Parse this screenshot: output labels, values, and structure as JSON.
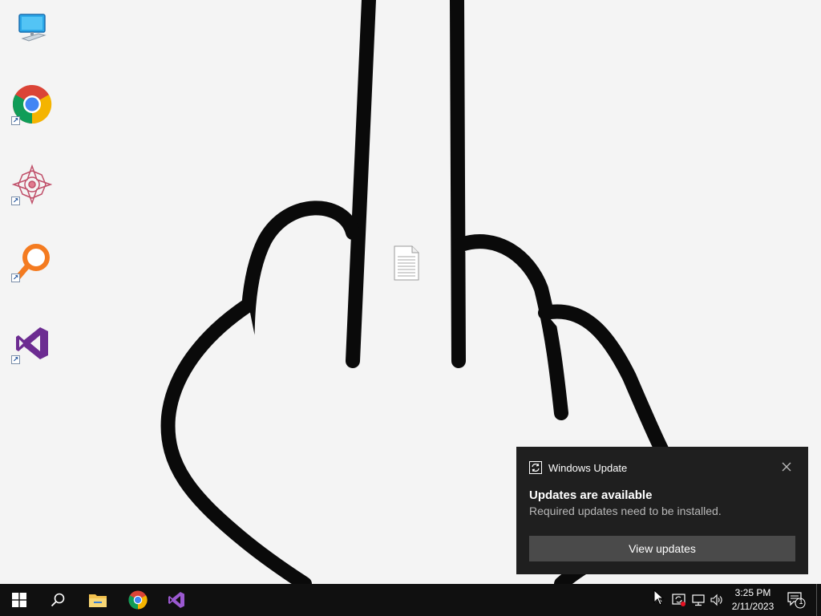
{
  "desktop": {
    "icons": [
      {
        "name": "this-pc-icon",
        "shortcut": false
      },
      {
        "name": "google-chrome-icon",
        "shortcut": true
      },
      {
        "name": "mandala-app-icon",
        "shortcut": true
      },
      {
        "name": "search-magnifier-app-icon",
        "shortcut": true
      },
      {
        "name": "visual-studio-icon",
        "shortcut": true
      }
    ],
    "center_item": "text-document-icon"
  },
  "toast": {
    "app_name": "Windows Update",
    "title": "Updates are available",
    "body": "Required updates need to be installed.",
    "action_label": "View updates",
    "app_icon": "windows-update-icon",
    "close_icon": "close-icon"
  },
  "taskbar": {
    "pinned": [
      "start-button",
      "search-button",
      "file-explorer",
      "google-chrome",
      "visual-studio"
    ],
    "tray": {
      "icons": [
        "show-hidden-icons",
        "windows-update-tray-icon",
        "network-icon",
        "volume-icon"
      ],
      "time": "3:25 PM",
      "date": "2/11/2023",
      "notification_count": "1"
    }
  },
  "colors": {
    "taskbar_bg": "#101010",
    "toast_bg": "#1f1f1f",
    "toast_button_bg": "#4a4a4a",
    "desktop_bg": "#f4f4f4"
  }
}
